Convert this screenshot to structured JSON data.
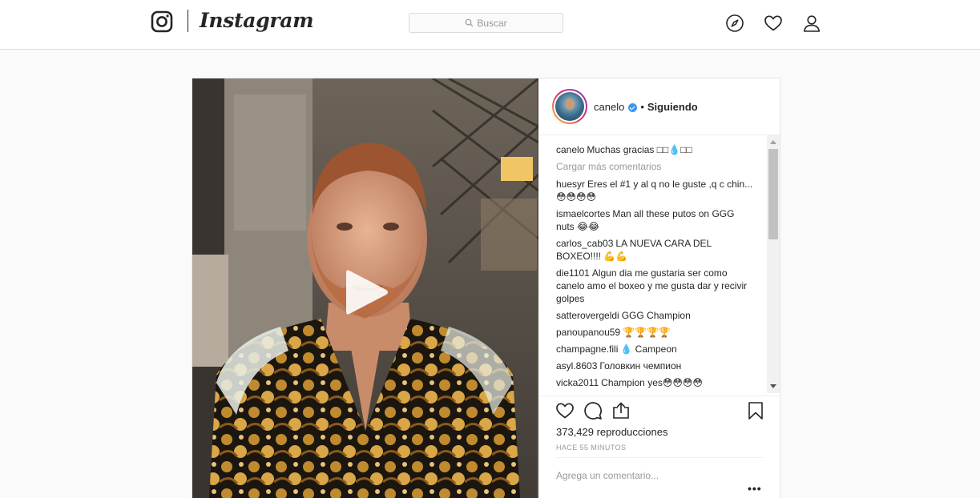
{
  "header": {
    "brand": "Instagram",
    "search_placeholder": "Buscar",
    "icons": [
      "instagram-logo-icon",
      "search-icon",
      "compass-icon",
      "heart-icon",
      "profile-icon"
    ]
  },
  "post": {
    "username": "canelo",
    "verified": true,
    "separator": "•",
    "follow_status": "Siguiendo",
    "media_type": "video",
    "comments": [
      {
        "user": "canelo",
        "text": "Muchas gracias □□💧□□"
      },
      {
        "user": "huesyr",
        "text": "Eres el #1 y al q no le guste ,q c chin...😳😳😳😳"
      },
      {
        "user": "ismaelcortes",
        "text": "Man all these putos on GGG nuts 😂😂"
      },
      {
        "user": "carlos_cab03",
        "text": "LA NUEVA CARA DEL BOXEO!!!! 💪💪"
      },
      {
        "user": "die1101",
        "text": "Algun dia me gustaria ser como canelo amo el boxeo y me gusta dar y recivir golpes"
      },
      {
        "user": "satterovergeldi",
        "text": "GGG Champion"
      },
      {
        "user": "panoupanou59",
        "text": "🏆🏆🏆🏆"
      },
      {
        "user": "champagne.fili",
        "text": "💧 Campeon"
      },
      {
        "user": "asyl.8603",
        "text": "Головкин чемпион"
      },
      {
        "user": "vicka2011",
        "text": "Champion yes😳😳😳😳"
      }
    ],
    "load_more_label": "Cargar más comentarios",
    "views": "373,429 reproducciones",
    "timestamp": "HACE 55 MINUTOS",
    "add_comment_placeholder": "Agrega un comentario...",
    "more_options": "•••"
  },
  "colors": {
    "accent": "#3897f0",
    "text": "#262626",
    "muted": "#999999",
    "border": "#dbdbdb",
    "background": "#fafafa"
  }
}
